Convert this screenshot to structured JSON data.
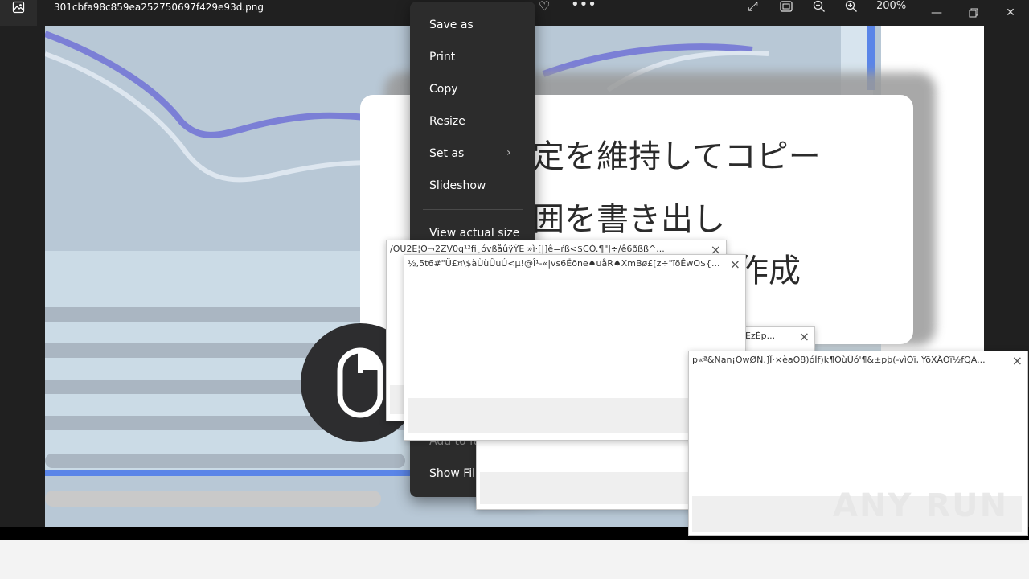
{
  "window": {
    "filename": "301cbfa98c859ea252750697f429e93d.png",
    "zoom": "200%",
    "icons": [
      "photos-app-icon",
      "heart-icon",
      "more-icon",
      "fullscreen-icon",
      "fit-icon",
      "zoom-out-icon",
      "zoom-in-icon",
      "minimize-icon",
      "maximize-icon",
      "close-icon"
    ]
  },
  "image": {
    "lines": [
      "定を維持してコピー",
      "囲を書き出し",
      "作成"
    ]
  },
  "context_menu": {
    "items": [
      "Save as",
      "Print",
      "Copy",
      "Resize",
      "Set as",
      "Slideshow",
      "View actual size",
      "Add to fa",
      "Show Film"
    ]
  },
  "dialogs": [
    {
      "title": "/OÜ2E¦Ò¬2ZV0q¹²fi¸óvßåûÿÝE »ì·[|]ê=ŕß<$CÒ.¶\"J÷/ê6ðßß^..."
    },
    {
      "title": "½,5t6#\"Ü£¤\\$àÙùÛuÚ<µ!@Î¹-«|vs6Ëðne♠uåR♠XmBø£[z÷\"ïõÊwO${..."
    },
    {
      "title": "ÉzÉp..."
    },
    {
      "title": "p«ª&Nan¡ÕwØÑ.]Ï·×èaO8)óÌf)k¶ÕùÛó'¶&±pþ(-vìÒï,'ÝõXÄÕï½fQÀ..."
    }
  ],
  "watermark": "ANY RUN"
}
